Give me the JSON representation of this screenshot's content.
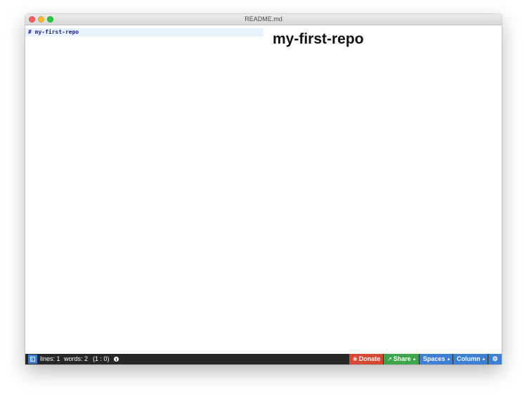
{
  "window": {
    "title": "README.md"
  },
  "editor": {
    "lines": [
      "# my-first-repo"
    ]
  },
  "preview": {
    "heading": "my-first-repo"
  },
  "statusbar": {
    "lines": "lines: 1",
    "words": "words: 2",
    "cursor": "(1 : 0)",
    "info_icon": "info-icon",
    "buttons": {
      "donate": {
        "icon": "❀",
        "label": "Donate"
      },
      "share": {
        "icon": "↗",
        "label": "Share",
        "caret": "▲"
      },
      "spaces": {
        "label": "Spaces",
        "caret": "▲"
      },
      "column": {
        "label": "Column",
        "caret": "▲"
      },
      "settings": {
        "icon": "⚙"
      }
    }
  },
  "colors": {
    "statusbar_bg": "#272727",
    "donate": "#d54834",
    "share": "#3ea64a",
    "blue": "#3e7fd6",
    "editor_active_line": "#e8f2fe",
    "editor_text": "#23238f"
  }
}
